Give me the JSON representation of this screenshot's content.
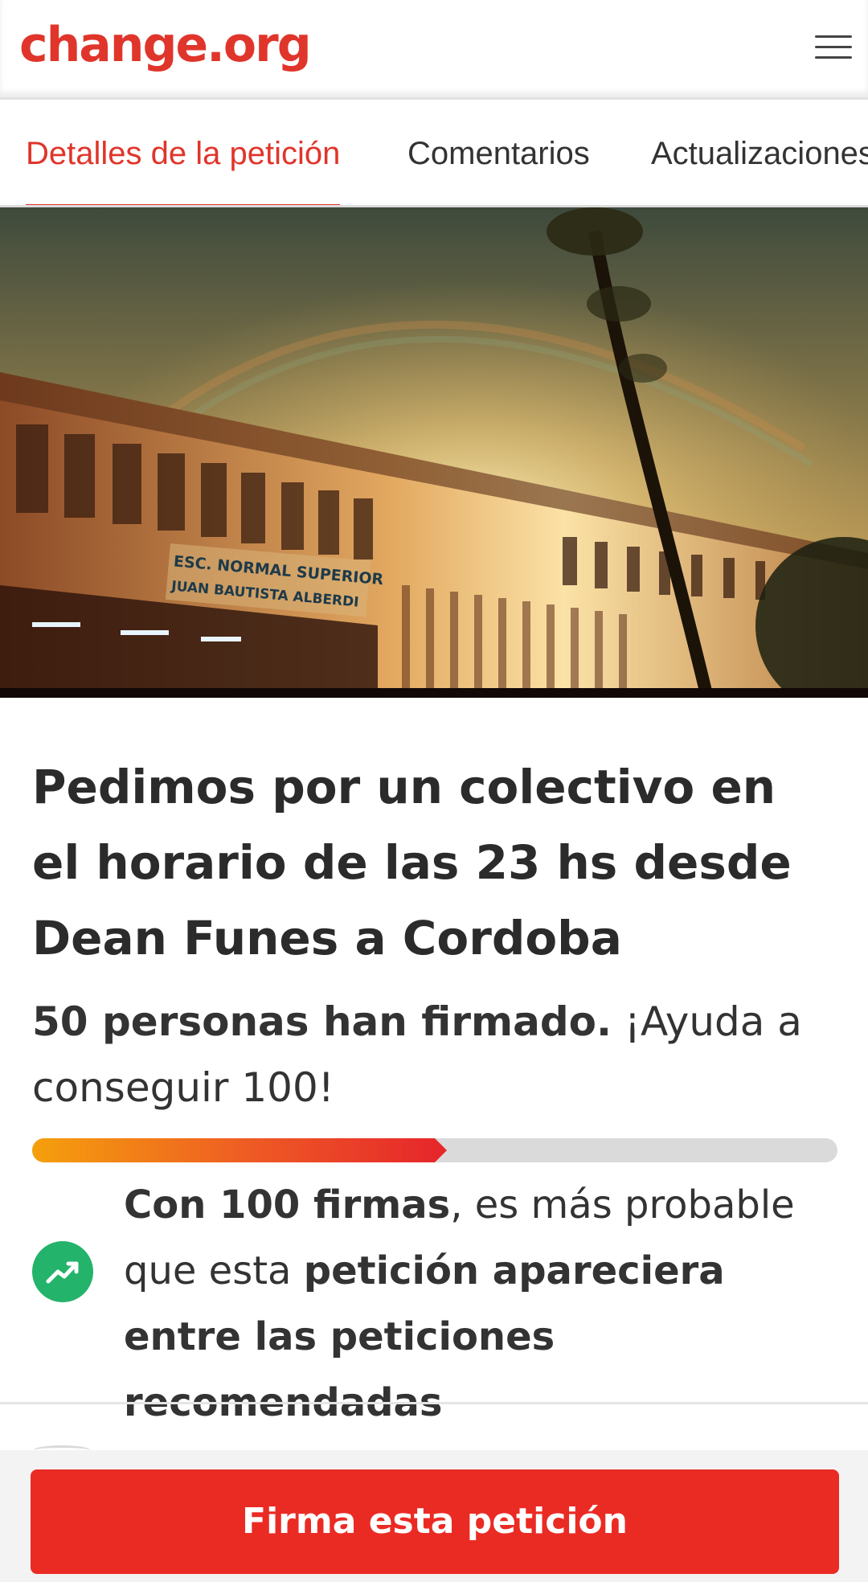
{
  "header": {
    "logo_text": "change.org",
    "logo_color": "#e0352b",
    "menu_icon": "hamburger-menu-icon"
  },
  "tabs": [
    {
      "label": "Detalles de la petición",
      "active": true
    },
    {
      "label": "Comentarios",
      "active": false
    },
    {
      "label": "Actualizaciones",
      "active": false
    }
  ],
  "hero": {
    "sign_line1": "ESC. NORMAL SUPERIOR",
    "sign_line2": "JUAN BAUTISTA ALBERDI"
  },
  "petition": {
    "title": "Pedimos por un colectivo en el horario de las 23 hs desde Dean Funes a Cordoba",
    "signed_bold": "50 personas han firmado.",
    "signed_rest": " ¡Ayuda a conseguir 100!",
    "progress_fraction": 0.5,
    "trend_icon": "trending-up-icon",
    "trend_bold1": "Con 100 firmas",
    "trend_text1": ", es más probable que esta ",
    "trend_bold2": "petición apareciera entre las peticiones recomendadas"
  },
  "cta": {
    "sign_label": "Firma esta petición",
    "color": "#ea2b24"
  }
}
